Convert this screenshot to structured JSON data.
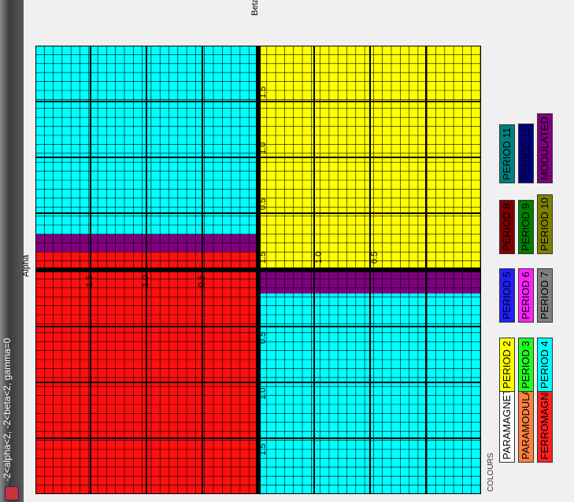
{
  "window": {
    "title": "-2<alpha<2, -2<beta<2, gamma=0"
  },
  "axes": {
    "beta_label": "Beta",
    "alpha_label": "Alpha"
  },
  "tick_labels": {
    "upper": [
      "1.5",
      "1.0",
      "0.5"
    ],
    "lower": [
      "0.5",
      "1.0",
      "1.5"
    ]
  },
  "legend": {
    "title": "COLOURS",
    "items": [
      {
        "label": "PARAMAGNETIC",
        "color": "#ffffff"
      },
      {
        "label": "PARAMODULATED",
        "color": "#ff8040"
      },
      {
        "label": "FERROMAGNETIC",
        "color": "#ff2020"
      },
      {
        "label": "PERIOD 2",
        "color": "#ffff00"
      },
      {
        "label": "PERIOD 3",
        "color": "#20ff20"
      },
      {
        "label": "PERIOD 4",
        "color": "#00ffff"
      },
      {
        "label": "PERIOD 5",
        "color": "#2020ff"
      },
      {
        "label": "PERIOD 6",
        "color": "#ff20ff"
      },
      {
        "label": "PERIOD 7",
        "color": "#808080"
      },
      {
        "label": "PERIOD 8",
        "color": "#800000"
      },
      {
        "label": "PERIOD 9",
        "color": "#008000"
      },
      {
        "label": "PERIOD 10",
        "color": "#808000"
      },
      {
        "label": "PERIOD 11",
        "color": "#008080"
      },
      {
        "label": "PERIOD 12",
        "color": "#000080"
      },
      {
        "label": "MODULATED",
        "color": "#800080"
      }
    ]
  },
  "colors": {
    "cyan": "#00ffff",
    "yellow": "#ffff00",
    "red": "#ff1010",
    "purple": "#800080",
    "gridline": "#000000"
  }
}
